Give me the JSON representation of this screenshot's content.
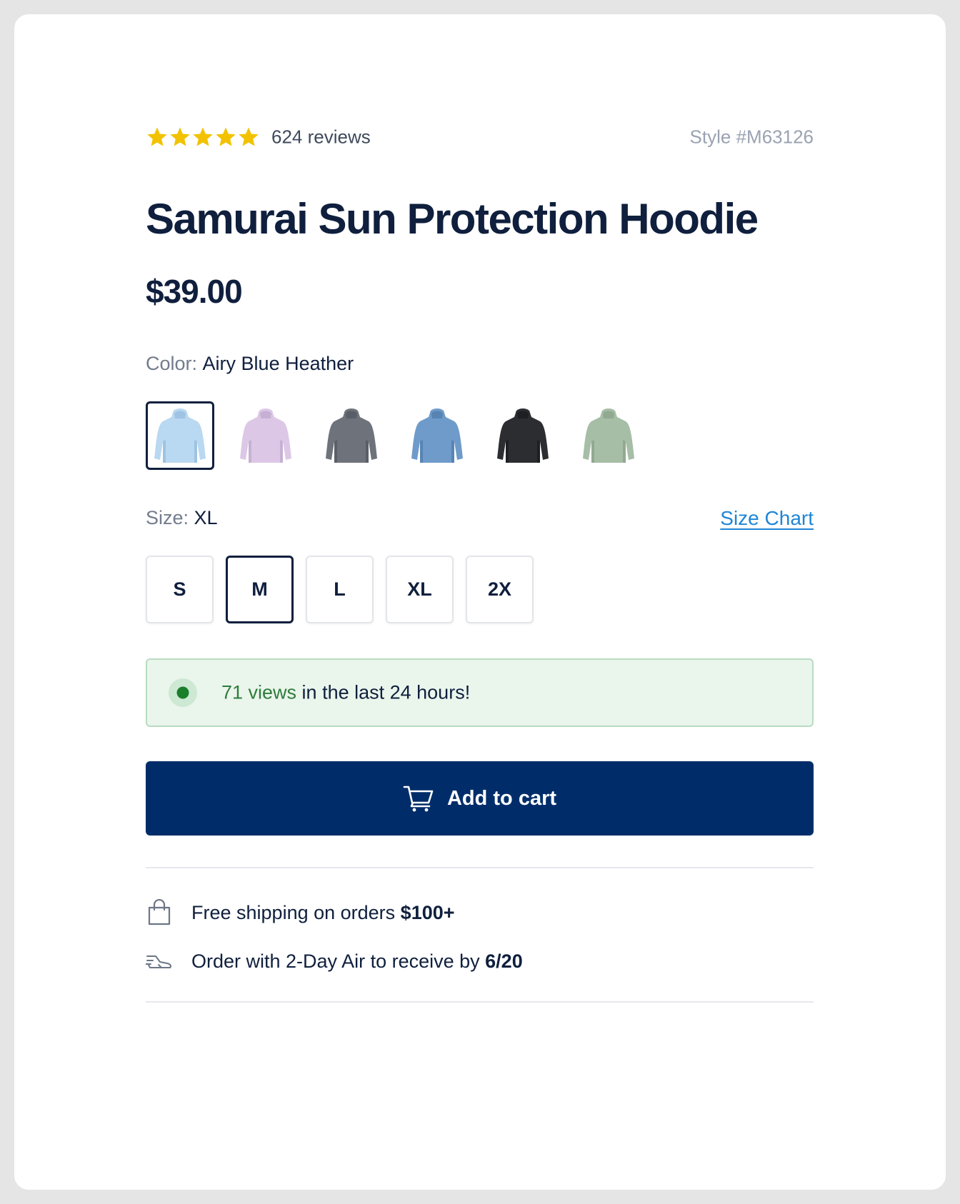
{
  "rating": {
    "stars": 5,
    "max_stars": 5,
    "reviews_label": "624 reviews",
    "star_color": "#f2c200"
  },
  "style_number": "Style #M63126",
  "product": {
    "title": "Samurai Sun Protection Hoodie",
    "price": "$39.00"
  },
  "color": {
    "label": "Color:",
    "selected": "Airy Blue Heather",
    "swatches": [
      {
        "fill": "#b9d8f1",
        "shade": "#9fc3e2",
        "selected": true
      },
      {
        "fill": "#dcc8e6",
        "shade": "#c6b0d4",
        "selected": false
      },
      {
        "fill": "#6e737b",
        "shade": "#5a5f67",
        "selected": false
      },
      {
        "fill": "#6e9bca",
        "shade": "#5884b3",
        "selected": false
      },
      {
        "fill": "#2b2d31",
        "shade": "#1d1f22",
        "selected": false
      },
      {
        "fill": "#a6bda6",
        "shade": "#91a991",
        "selected": false
      }
    ]
  },
  "size": {
    "label": "Size:",
    "selected": "XL",
    "chart_link": "Size Chart",
    "options": [
      {
        "label": "S",
        "selected": false
      },
      {
        "label": "M",
        "selected": true
      },
      {
        "label": "L",
        "selected": false
      },
      {
        "label": "XL",
        "selected": false
      },
      {
        "label": "2X",
        "selected": false
      }
    ]
  },
  "views_banner": {
    "count": "71 views",
    "suffix": " in the last 24 hours!"
  },
  "cart": {
    "label": "Add to cart",
    "icon": "cart-icon",
    "bg_color": "#002d69"
  },
  "info": {
    "shipping_prefix": "Free shipping on orders ",
    "shipping_threshold": "$100+",
    "shipping_icon": "shopping-bag-icon",
    "delivery_prefix": "Order with 2-Day Air to receive by ",
    "delivery_date": "6/20",
    "delivery_icon": "fast-shoe-icon"
  }
}
